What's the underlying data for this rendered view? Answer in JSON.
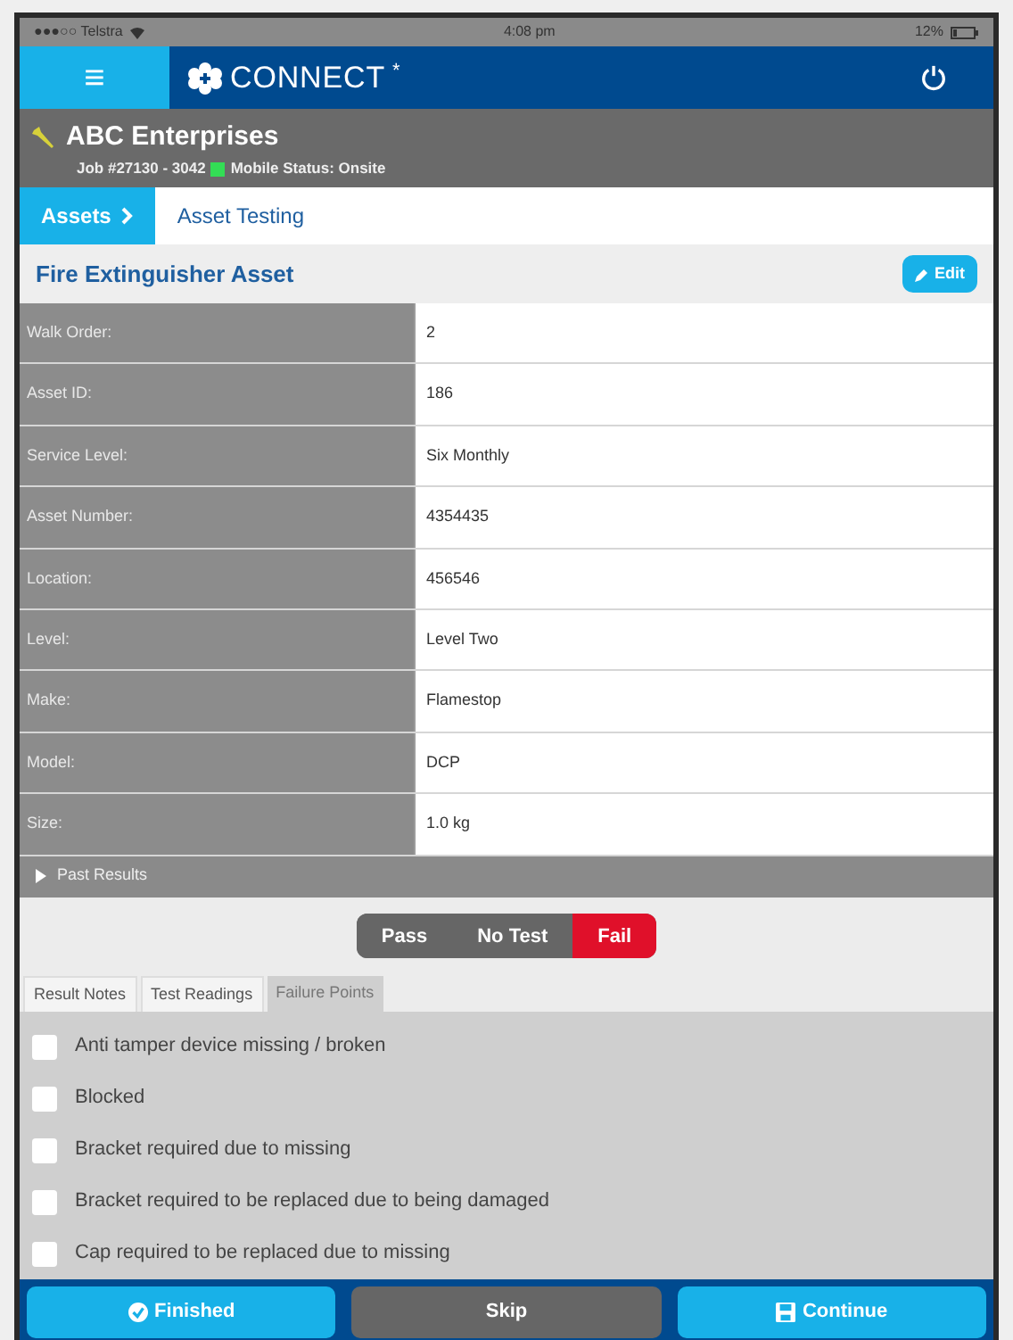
{
  "status_bar": {
    "carrier": "●●●○○ Telstra",
    "time": "4:08 pm",
    "battery": "12%"
  },
  "header": {
    "menu": "≡",
    "app_name": "CONNECT",
    "app_mark": "*"
  },
  "job": {
    "customer": "ABC Enterprises",
    "job_number": "Job #27130 - 3042",
    "color": "#33dd55",
    "mobile_status": "Mobile Status: Onsite"
  },
  "breadcrumb": [
    {
      "label": "Assets",
      "selected": true
    },
    {
      "label": "Asset Testing",
      "selected": false
    }
  ],
  "asset": {
    "title": "Fire Extinguisher Asset",
    "edit_button": "Edit"
  },
  "fields": [
    {
      "label": "Walk Order:",
      "value": "2"
    },
    {
      "label": "Asset ID:",
      "value": "186"
    },
    {
      "label": "Service Level:",
      "value": "Six Monthly"
    },
    {
      "label": "Asset Number:",
      "value": "4354435"
    },
    {
      "label": "Location:",
      "value": "456546"
    },
    {
      "label": "Level:",
      "value": "Level Two"
    },
    {
      "label": "Make:",
      "value": "Flamestop"
    },
    {
      "label": "Model:",
      "value": "DCP"
    },
    {
      "label": "Size:",
      "value": "1.0 kg"
    }
  ],
  "past_results": {
    "label": "Past Results",
    "expanded": false
  },
  "result": [
    {
      "label": "Pass",
      "selected": false
    },
    {
      "label": "No Test",
      "selected": false
    },
    {
      "label": "Fail",
      "selected": true
    }
  ],
  "tabs": [
    {
      "label": "Result Notes",
      "selected": false
    },
    {
      "label": "Test Readings",
      "selected": false
    },
    {
      "label": "Failure Points",
      "selected": true
    }
  ],
  "failure_points": [
    {
      "label": "Anti tamper device missing / broken",
      "checked": false
    },
    {
      "label": "Blocked",
      "checked": false
    },
    {
      "label": "Bracket required due to missing",
      "checked": false
    },
    {
      "label": "Bracket required to be replaced due to being damaged",
      "checked": false
    },
    {
      "label": "Cap required to be replaced due to missing",
      "checked": false
    }
  ],
  "footer": [
    {
      "label": "Finished",
      "kind": "finished"
    },
    {
      "label": "Skip",
      "kind": "skip"
    },
    {
      "label": "Continue",
      "kind": "continue"
    }
  ]
}
